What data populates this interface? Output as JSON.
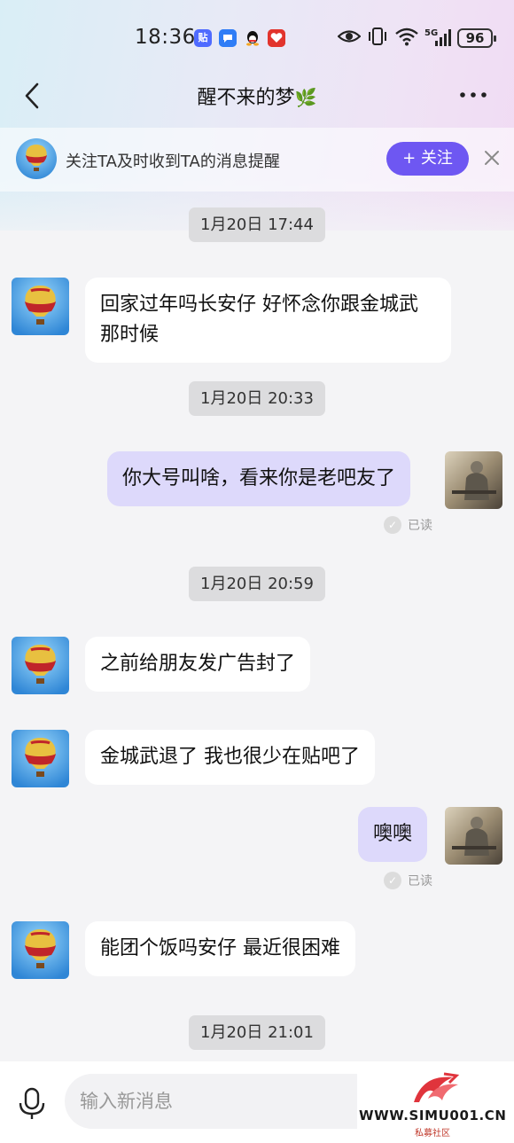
{
  "status_bar": {
    "time": "18:36",
    "notification_icons": [
      "tieba-icon",
      "message-icon",
      "qq-icon",
      "app-icon"
    ],
    "tieba_badge": "贴",
    "battery": "96"
  },
  "nav": {
    "title": "醒不来的梦",
    "title_emoji": "🌿"
  },
  "follow_bar": {
    "text": "关注TA及时收到TA的消息提醒",
    "follow_button": "+ 关注"
  },
  "messages": [
    {
      "type": "timestamp",
      "text": "1月20日 17:44"
    },
    {
      "type": "msg",
      "side": "left",
      "text": "回家过年吗长安仔 好怀念你跟金城武那时候"
    },
    {
      "type": "timestamp",
      "text": "1月20日 20:33"
    },
    {
      "type": "msg",
      "side": "right",
      "text": "你大号叫啥，看来你是老吧友了",
      "status": "已读"
    },
    {
      "type": "timestamp",
      "text": "1月20日 20:59"
    },
    {
      "type": "msg",
      "side": "left",
      "text": "之前给朋友发广告封了"
    },
    {
      "type": "msg",
      "side": "left",
      "text": "金城武退了 我也很少在贴吧了"
    },
    {
      "type": "msg",
      "side": "right",
      "text": "噢噢",
      "status": "已读"
    },
    {
      "type": "msg",
      "side": "left",
      "text": "能团个饭吗安仔 最近很困难"
    },
    {
      "type": "timestamp",
      "text": "1月20日 21:01"
    }
  ],
  "input": {
    "placeholder": "输入新消息"
  },
  "watermark": {
    "url": "WWW.SIMU001.CN",
    "name": "私募社区"
  },
  "colors": {
    "accent": "#6e57f2",
    "my_bubble": "#ddd9fb",
    "their_bubble": "#ffffff",
    "timestamp_bg": "#dcdcde"
  }
}
